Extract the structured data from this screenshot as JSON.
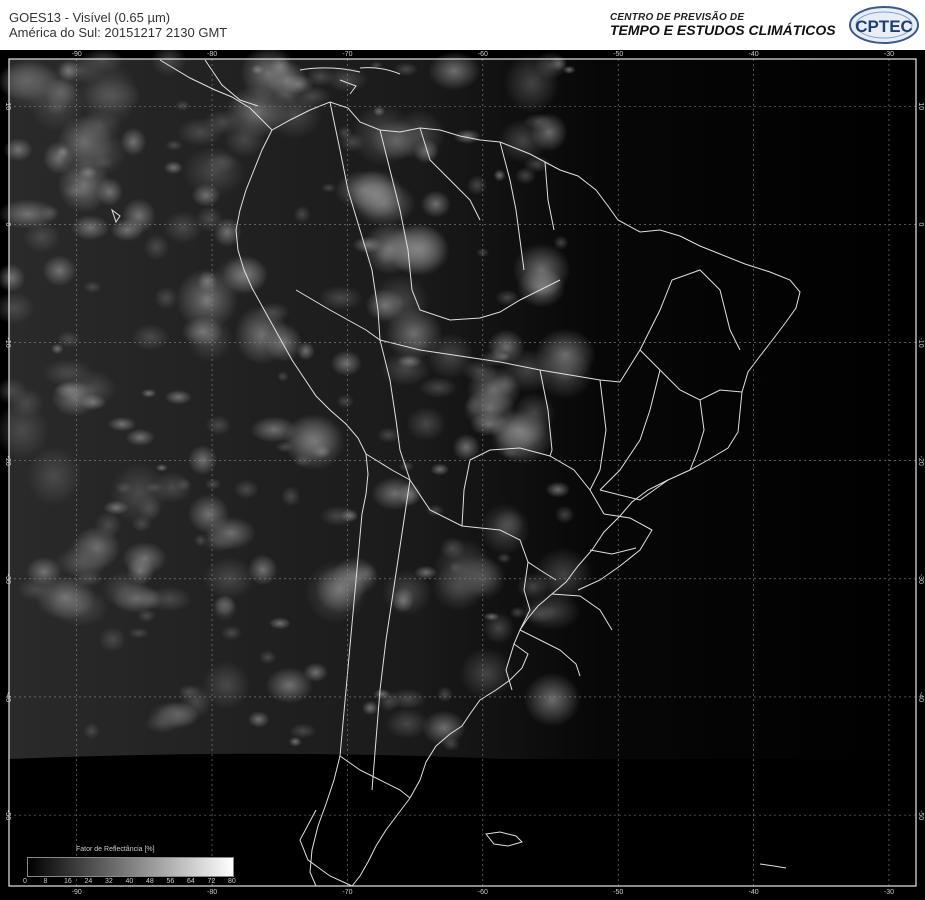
{
  "header": {
    "title_line1": "GOES13 - Visível (0.65 µm)",
    "title_line2": "América do Sul: 20151217 2130 GMT",
    "org_line1": "CENTRO DE PREVISÃO DE",
    "org_line2": "TEMPO E ESTUDOS CLIMÁTICOS",
    "logo_text": "CPTEC"
  },
  "map": {
    "lon_labels": [
      "-90",
      "-80",
      "-70",
      "-60",
      "-50",
      "-40",
      "-30"
    ],
    "lat_labels": [
      "10",
      "0",
      "-10",
      "-20",
      "-30",
      "-40",
      "-50"
    ],
    "lon_range": [
      -95,
      -28
    ],
    "lat_range": [
      14,
      -56
    ]
  },
  "colorbar": {
    "title": "Fator de Reflectância [%]",
    "ticks": [
      "0",
      "8",
      "16",
      "24",
      "32",
      "40",
      "48",
      "56",
      "64",
      "72",
      "80"
    ]
  },
  "colors": {
    "background": "#000000",
    "grid": "#8a8a8a",
    "border": "#e6e6e6",
    "header_bg": "#ffffff"
  }
}
